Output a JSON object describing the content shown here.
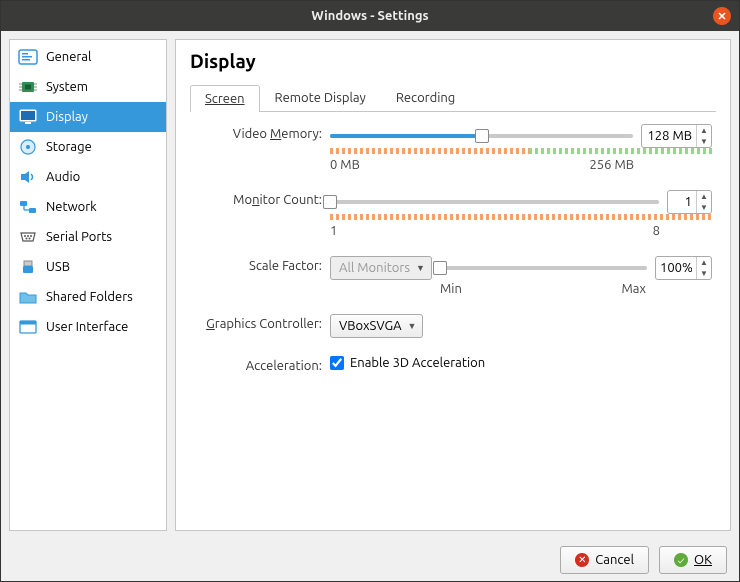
{
  "window": {
    "title": "Windows - Settings"
  },
  "sidebar": {
    "items": [
      {
        "label": "General"
      },
      {
        "label": "System"
      },
      {
        "label": "Display"
      },
      {
        "label": "Storage"
      },
      {
        "label": "Audio"
      },
      {
        "label": "Network"
      },
      {
        "label": "Serial Ports"
      },
      {
        "label": "USB"
      },
      {
        "label": "Shared Folders"
      },
      {
        "label": "User Interface"
      }
    ],
    "selected_index": 2
  },
  "page": {
    "title": "Display"
  },
  "tabs": {
    "items": [
      {
        "label": "Screen"
      },
      {
        "label": "Remote Display"
      },
      {
        "label": "Recording"
      }
    ],
    "active_index": 0
  },
  "screen": {
    "video_memory": {
      "label": "Video Memory:",
      "min_label": "0 MB",
      "max_label": "256 MB",
      "value": "128 MB",
      "fill_pct": 50,
      "segments": {
        "orange_end_pct": 52,
        "green_start_pct": 52,
        "green_end_pct": 100
      }
    },
    "monitor_count": {
      "label": "Monitor Count:",
      "min_label": "1",
      "max_label": "8",
      "value": "1",
      "fill_pct": 0,
      "segments": {
        "orange_end_pct": 100
      }
    },
    "scale_factor": {
      "label": "Scale Factor:",
      "monitor_select": "All Monitors",
      "min_label": "Min",
      "max_label": "Max",
      "value": "100%",
      "fill_pct": 0
    },
    "graphics_controller": {
      "label": "Graphics Controller:",
      "value": "VBoxSVGA"
    },
    "acceleration": {
      "label": "Acceleration:",
      "checkbox_label": "Enable 3D Acceleration",
      "checked": true
    }
  },
  "footer": {
    "cancel": "Cancel",
    "ok": "OK"
  }
}
